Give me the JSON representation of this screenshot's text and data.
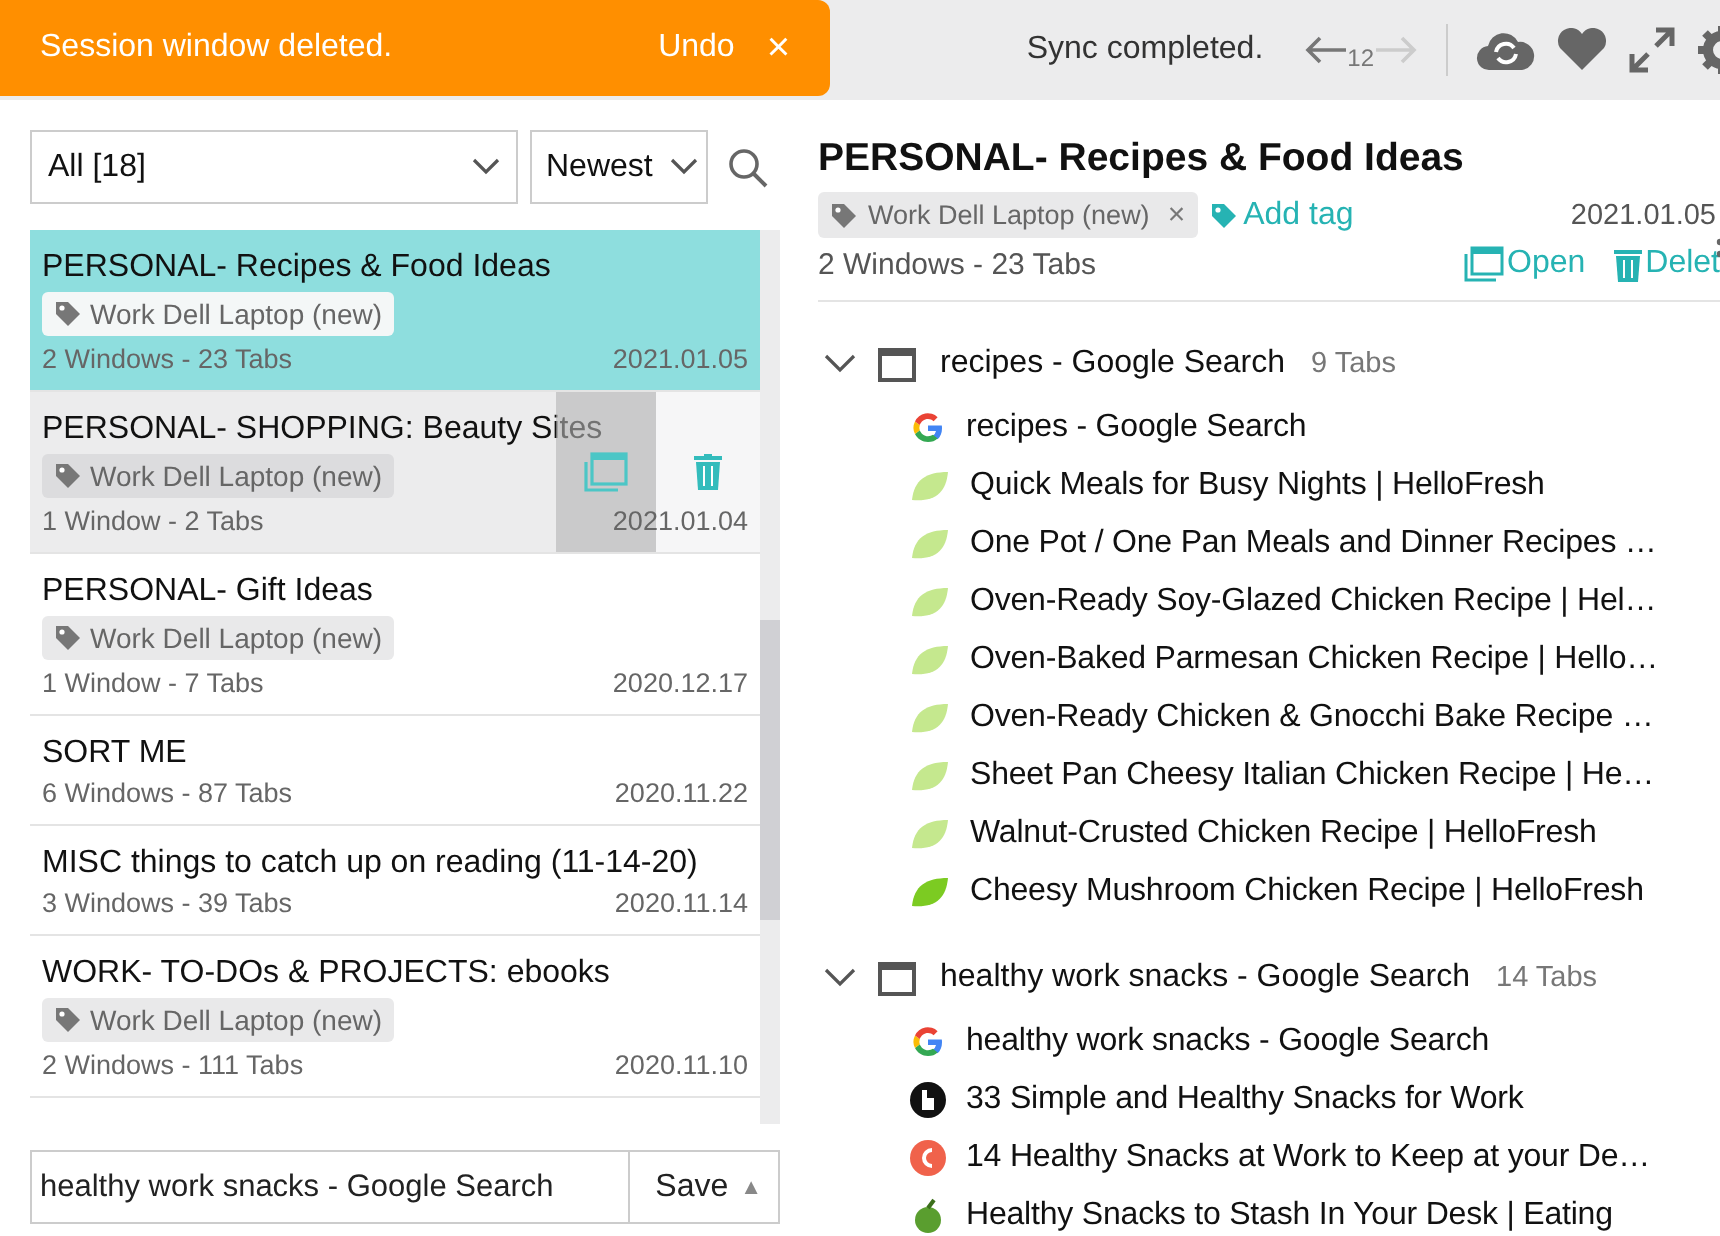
{
  "toast": {
    "message": "Session window deleted.",
    "action": "Undo",
    "close": "×"
  },
  "toolbar": {
    "status": "Sync completed.",
    "history_count": "12"
  },
  "filters": {
    "group": "All [18]",
    "sort": "Newest"
  },
  "sessions": [
    {
      "title": "PERSONAL- Recipes & Food Ideas",
      "tag": "Work Dell Laptop (new)",
      "summary": "2 Windows - 23 Tabs",
      "date": "2021.01.05",
      "selected": true,
      "hovered": false
    },
    {
      "title": "PERSONAL- SHOPPING: Beauty Sites",
      "tag": "Work Dell Laptop (new)",
      "summary": "1 Window - 2 Tabs",
      "date": "2021.01.04",
      "selected": false,
      "hovered": true
    },
    {
      "title": "PERSONAL- Gift Ideas",
      "tag": "Work Dell Laptop (new)",
      "summary": "1 Window - 7 Tabs",
      "date": "2020.12.17",
      "selected": false,
      "hovered": false
    },
    {
      "title": "SORT ME",
      "summary": "6 Windows - 87 Tabs",
      "date": "2020.11.22",
      "selected": false,
      "hovered": false
    },
    {
      "title": "MISC things to catch up on reading (11-14-20)",
      "summary": "3 Windows - 39 Tabs",
      "date": "2020.11.14",
      "selected": false,
      "hovered": false
    },
    {
      "title": "WORK- TO-DOs & PROJECTS: ebooks",
      "tag": "Work Dell Laptop (new)",
      "summary": "2 Windows - 111 Tabs",
      "date": "2020.11.10",
      "selected": false,
      "hovered": false
    }
  ],
  "save": {
    "value": "healthy work snacks - Google Search",
    "button": "Save",
    "caret": "▲"
  },
  "detail": {
    "title": "PERSONAL- Recipes & Food Ideas",
    "tag": "Work Dell Laptop (new)",
    "tag_remove": "×",
    "add_tag": "Add tag",
    "date": "2021.01.05",
    "summary": "2 Windows - 23 Tabs",
    "open": "Open",
    "delete": "Delet",
    "windows": [
      {
        "title": "recipes - Google Search",
        "count": "9 Tabs",
        "expanded": true,
        "tabs": [
          {
            "title": "recipes - Google Search",
            "kind": "google"
          },
          {
            "title": "Quick Meals for Busy Nights | HelloFresh",
            "kind": "leaf"
          },
          {
            "title": "One Pot / One Pan Meals and Dinner Recipes …",
            "kind": "leaf"
          },
          {
            "title": "Oven-Ready Soy-Glazed Chicken Recipe | Hel…",
            "kind": "leaf"
          },
          {
            "title": "Oven-Baked Parmesan Chicken Recipe | Hello…",
            "kind": "leaf"
          },
          {
            "title": "Oven-Ready Chicken & Gnocchi Bake Recipe …",
            "kind": "leaf"
          },
          {
            "title": "Sheet Pan Cheesy Italian Chicken Recipe | He…",
            "kind": "leaf"
          },
          {
            "title": "Walnut-Crusted Chicken Recipe | HelloFresh",
            "kind": "leaf"
          },
          {
            "title": "Cheesy Mushroom Chicken Recipe | HelloFresh",
            "kind": "leaf-dark"
          }
        ]
      },
      {
        "title": "healthy work snacks - Google Search",
        "count": "14 Tabs",
        "expanded": true,
        "tabs": [
          {
            "title": "healthy work snacks - Google Search",
            "kind": "google"
          },
          {
            "title": "33 Simple and Healthy Snacks for Work",
            "kind": "dark-circle"
          },
          {
            "title": "14 Healthy Snacks at Work to Keep at your De…",
            "kind": "red-circle"
          },
          {
            "title": "Healthy Snacks to Stash In Your Desk | Eating",
            "kind": "apple"
          }
        ]
      }
    ]
  }
}
